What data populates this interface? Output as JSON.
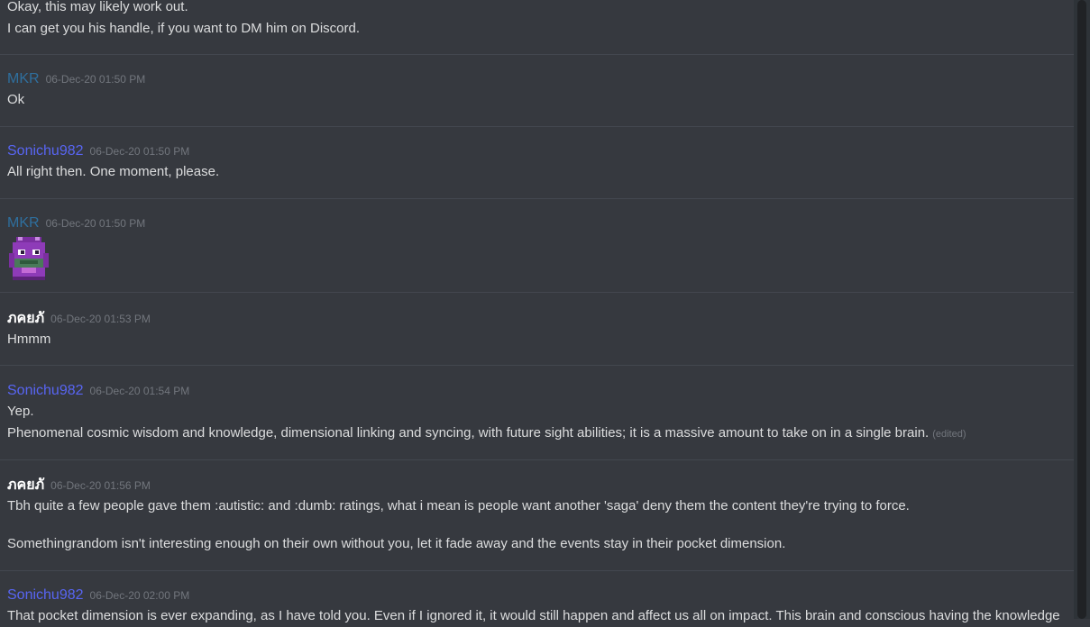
{
  "colors": {
    "background": "#36393f",
    "mkr": "#2f6f9e",
    "sonichu": "#5865f2",
    "nausea": "#ffffff",
    "timestamp": "#72767d",
    "text": "#dcddde"
  },
  "messages": [
    {
      "lines": [
        "Okay, this may likely work out.",
        "I can get you his handle, if you want to DM him on Discord."
      ]
    },
    {
      "author": "MKR",
      "timestamp": "06-Dec-20 01:50 PM",
      "lines": [
        "Ok"
      ]
    },
    {
      "author": "Sonichu982",
      "timestamp": "06-Dec-20 01:50 PM",
      "lines": [
        "All right then.  One moment, please."
      ]
    },
    {
      "author": "MKR",
      "timestamp": "06-Dec-20 01:50 PM",
      "emoji": "purple-character-emoji"
    },
    {
      "author": "ภคยภั",
      "timestamp": "06-Dec-20 01:53 PM",
      "lines": [
        "Hmmm"
      ]
    },
    {
      "author": "Sonichu982",
      "timestamp": "06-Dec-20 01:54 PM",
      "lines": [
        "Yep.",
        "Phenomenal cosmic wisdom and knowledge, dimensional linking and syncing, with future sight abilities; it is a massive amount to take on in a single brain."
      ],
      "edited": "(edited)"
    },
    {
      "author": "ภคยภั",
      "timestamp": "06-Dec-20 01:56 PM",
      "lines": [
        "Tbh quite a few people gave them :autistic: and :dumb: ratings, what i mean is people want another 'saga' deny them the content they're trying to force.",
        "Somethingrandom isn't interesting enough on their own without you, let it fade away and the events stay in their pocket dimension."
      ]
    },
    {
      "author": "Sonichu982",
      "timestamp": "06-Dec-20 02:00 PM",
      "lines": [
        "That pocket dimension is ever expanding, as I have told you.  Even if I ignored it, it would still happen and affect us all on impact.  This brain and conscious having the knowledge"
      ]
    }
  ]
}
